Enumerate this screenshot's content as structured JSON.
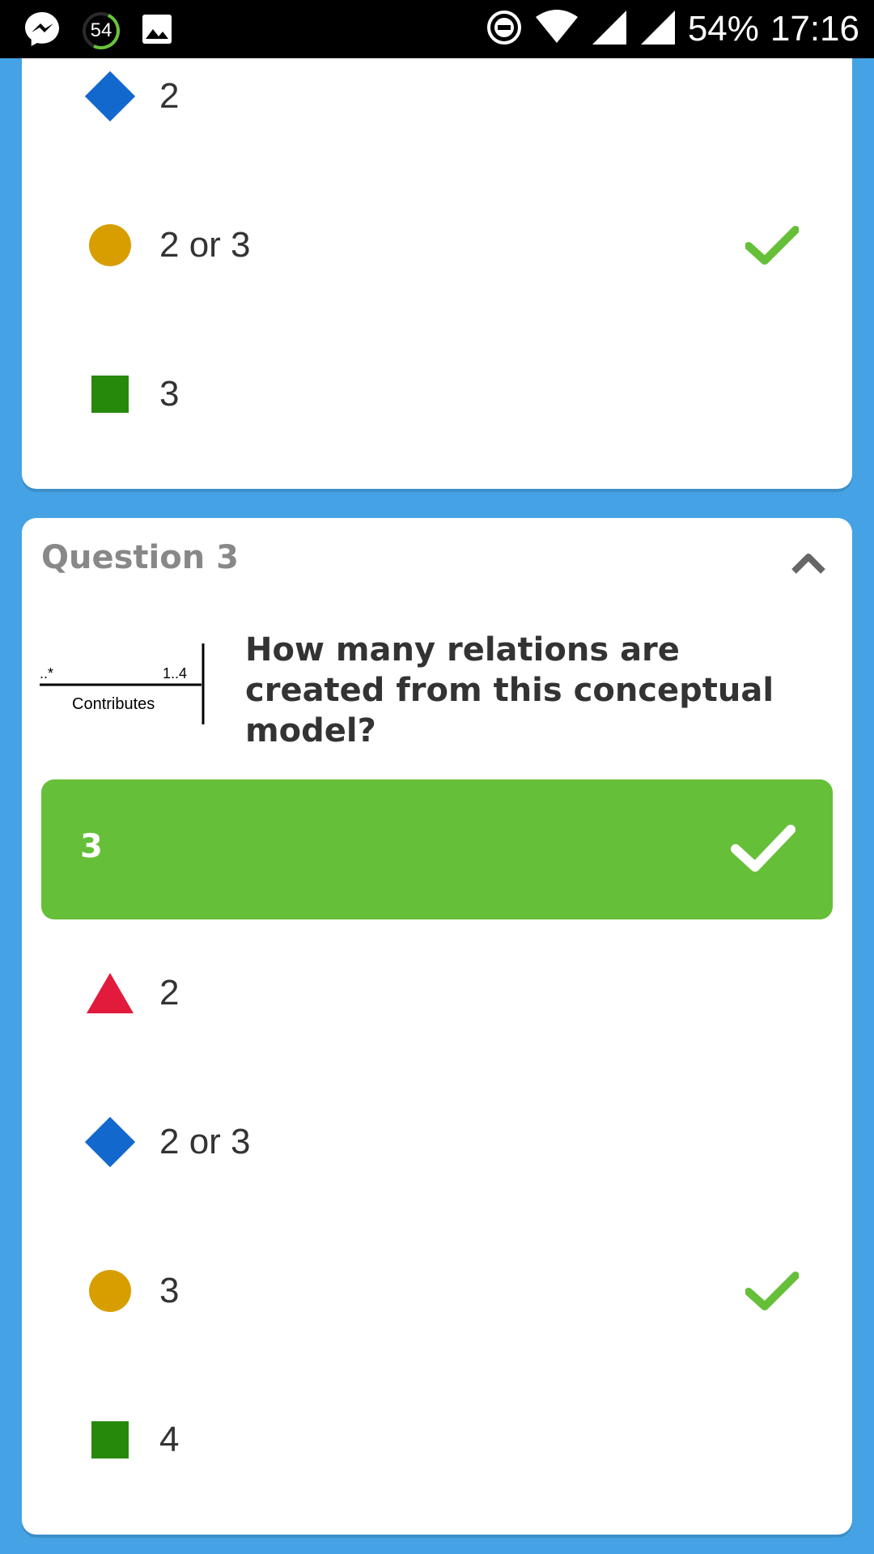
{
  "status_bar": {
    "battery": "54%",
    "time": "17:16",
    "notification_count": "54"
  },
  "previous_question": {
    "answers": [
      {
        "shape": "diamond",
        "color": "#1368ce",
        "text": "2",
        "correct": false
      },
      {
        "shape": "circle",
        "color": "#d89e00",
        "text": "2 or 3",
        "correct": true
      },
      {
        "shape": "square",
        "color": "#26890c",
        "text": "3",
        "correct": false
      }
    ]
  },
  "question3": {
    "title": "Question 3",
    "text": "How many relations are created from this conceptual model?",
    "image": {
      "left_label": "..*",
      "right_label": "1..4",
      "caption": "Contributes"
    },
    "correct_answer": "3",
    "correct_color": "#66bf39",
    "answers": [
      {
        "shape": "triangle",
        "color": "#e21b3c",
        "text": "2",
        "correct": false
      },
      {
        "shape": "diamond",
        "color": "#1368ce",
        "text": "2 or 3",
        "correct": false
      },
      {
        "shape": "circle",
        "color": "#d89e00",
        "text": "3",
        "correct": true
      },
      {
        "shape": "square",
        "color": "#26890c",
        "text": "4",
        "correct": false
      }
    ]
  },
  "colors": {
    "background": "#45a3e5",
    "check_green": "#66bf39"
  }
}
